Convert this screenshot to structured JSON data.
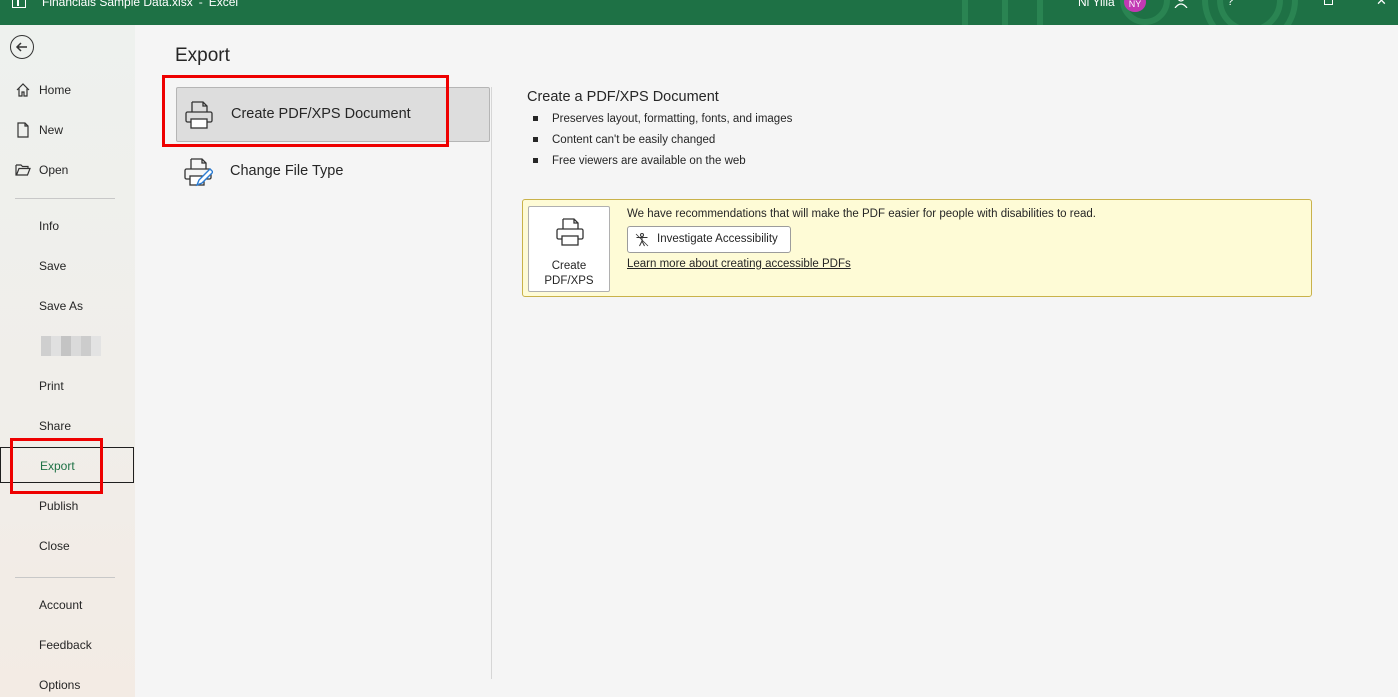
{
  "titlebar": {
    "file_name": "Financials Sample Data.xlsx",
    "separator": "-",
    "app_name": "Excel",
    "user_name": "Ni Yilia",
    "user_initials": "NY",
    "help_glyph": "?",
    "close_glyph": "✕"
  },
  "nav": {
    "items": [
      {
        "label": "Home",
        "icon": "home-icon"
      },
      {
        "label": "New",
        "icon": "new-file-icon"
      },
      {
        "label": "Open",
        "icon": "folder-open-icon"
      },
      {
        "label": "Info"
      },
      {
        "label": "Save"
      },
      {
        "label": "Save As"
      },
      {
        "label": "Print"
      },
      {
        "label": "Share"
      },
      {
        "label": "Export",
        "active": true
      },
      {
        "label": "Publish"
      },
      {
        "label": "Close"
      },
      {
        "label": "Account"
      },
      {
        "label": "Feedback"
      },
      {
        "label": "Options"
      }
    ]
  },
  "export": {
    "title": "Export",
    "options": [
      {
        "label": "Create PDF/XPS Document",
        "icon": "pdf-xps-document-icon",
        "selected": true
      },
      {
        "label": "Change File Type",
        "icon": "change-file-type-icon",
        "selected": false
      }
    ],
    "detail": {
      "title": "Create a PDF/XPS Document",
      "bullets": [
        "Preserves layout, formatting, fonts, and images",
        "Content can't be easily changed",
        "Free viewers are available on the web"
      ],
      "notice": {
        "text": "We have recommendations that will make the PDF easier for people with disabilities to read.",
        "button_line1": "Create",
        "button_line2": "PDF/XPS",
        "investigate_label": "Investigate Accessibility",
        "learn_more_link": "Learn more about creating accessible PDFs"
      }
    }
  },
  "colors": {
    "titlebar_bg": "#1e7145",
    "active_text": "#1e7145",
    "highlight_box": "#ee0000",
    "notice_bg": "#fefbd6",
    "avatar_bg": "#c239b3"
  }
}
